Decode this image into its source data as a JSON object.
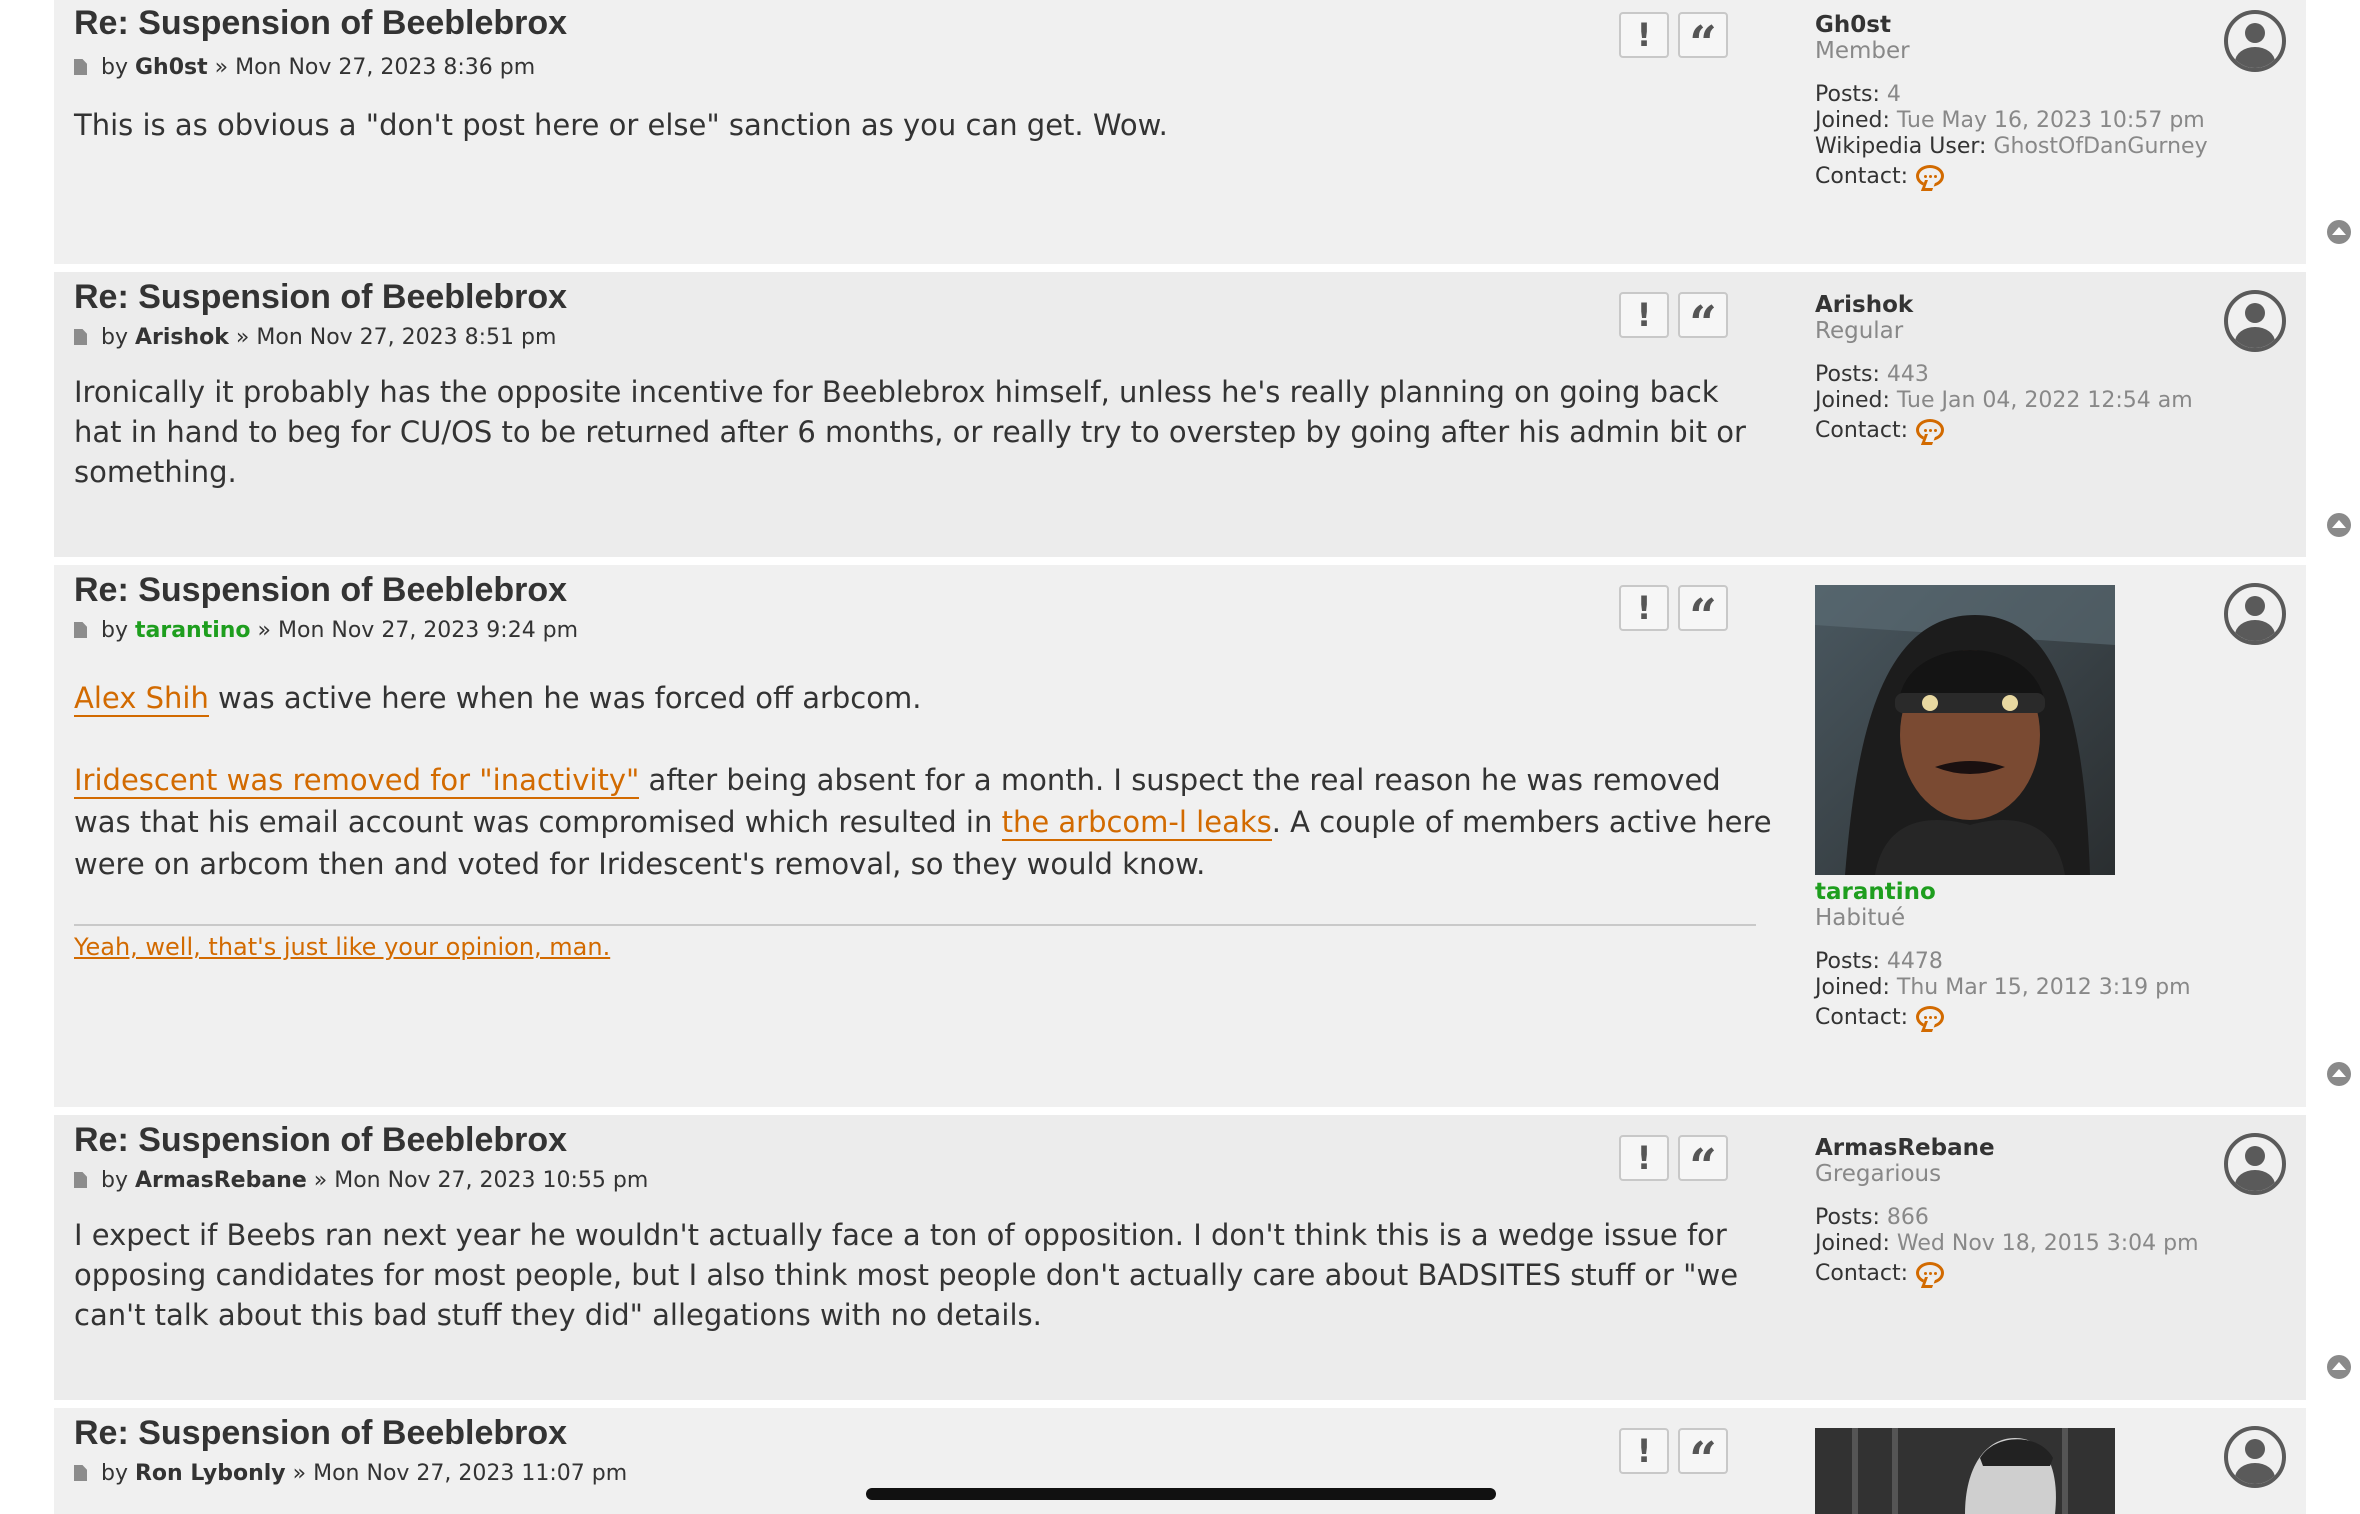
{
  "ui": {
    "report_glyph": "!",
    "quote_glyph": "“",
    "by_word": "by",
    "sep": "»",
    "posts_label": "Posts:",
    "joined_label": "Joined:",
    "wiki_label": "Wikipedia User:",
    "contact_label": "Contact:",
    "accent_color": "#d26a00",
    "green_user_color": "#1e9e1e"
  },
  "posts": [
    {
      "title": "Re: Suspension of Beeblebrox",
      "author": "Gh0st",
      "date": "Mon Nov 27, 2023 8:36 pm",
      "body": "This is as obvious a \"don't post here or else\" sanction as you can get. Wow.",
      "profile": {
        "username": "Gh0st",
        "rank": "Member",
        "posts": "4",
        "joined": "Tue May 16, 2023 10:57 pm",
        "wikipedia_user": "GhostOfDanGurney"
      }
    },
    {
      "title": "Re: Suspension of Beeblebrox",
      "author": "Arishok",
      "date": "Mon Nov 27, 2023 8:51 pm",
      "body": "Ironically it probably has the opposite incentive for Beeblebrox himself, unless he's really planning on going back hat in hand to beg for CU/OS to be returned after 6 months, or really try to overstep by going after his admin bit or something.",
      "profile": {
        "username": "Arishok",
        "rank": "Regular",
        "posts": "443",
        "joined": "Tue Jan 04, 2022 12:54 am"
      }
    },
    {
      "title": "Re: Suspension of Beeblebrox",
      "author": "tarantino",
      "date": "Mon Nov 27, 2023 9:24 pm",
      "para1_link": "Alex Shih",
      "para1_text": " was active here when he was forced off arbcom.",
      "para2_link1": "Iridescent was removed for \"inactivity\"",
      "para2_text1": " after being absent for a month. I suspect the real reason he was removed was that his email account was compromised which resulted in ",
      "para2_link2": "the arbcom-l leaks",
      "para2_text2": ". A couple of members active here were on arbcom then and voted for Iridescent's removal, so they would know.",
      "signature": "Yeah, well, that's just like your opinion, man.",
      "profile": {
        "username": "tarantino",
        "rank": "Habitué",
        "posts": "4478",
        "joined": "Thu Mar 15, 2012 3:19 pm"
      }
    },
    {
      "title": "Re: Suspension of Beeblebrox",
      "author": "ArmasRebane",
      "date": "Mon Nov 27, 2023 10:55 pm",
      "body": "I expect if Beebs ran next year he wouldn't actually face a ton of opposition. I don't think this is a wedge issue for opposing candidates for most people, but I also think most people don't actually care about BADSITES stuff or \"we can't talk about this bad stuff they did\" allegations with no details.",
      "profile": {
        "username": "ArmasRebane",
        "rank": "Gregarious",
        "posts": "866",
        "joined": "Wed Nov 18, 2015 3:04 pm"
      }
    },
    {
      "title": "Re: Suspension of Beeblebrox",
      "author": "Ron Lybonly",
      "date": "Mon Nov 27, 2023 11:07 pm"
    }
  ]
}
